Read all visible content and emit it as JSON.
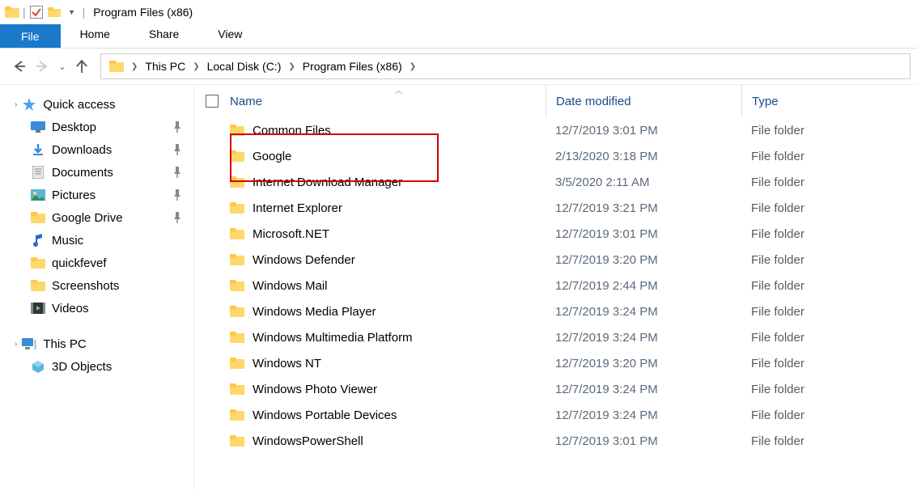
{
  "window": {
    "title": "Program Files (x86)"
  },
  "ribbon": {
    "file": "File",
    "tabs": [
      "Home",
      "Share",
      "View"
    ]
  },
  "breadcrumb": [
    "This PC",
    "Local Disk (C:)",
    "Program Files (x86)"
  ],
  "sidebar": {
    "quick_access": "Quick access",
    "items": [
      {
        "label": "Desktop",
        "pinned": true,
        "kind": "desktop"
      },
      {
        "label": "Downloads",
        "pinned": true,
        "kind": "downloads"
      },
      {
        "label": "Documents",
        "pinned": true,
        "kind": "documents"
      },
      {
        "label": "Pictures",
        "pinned": true,
        "kind": "pictures"
      },
      {
        "label": "Google Drive",
        "pinned": true,
        "kind": "folder"
      },
      {
        "label": "Music",
        "pinned": false,
        "kind": "music"
      },
      {
        "label": "quickfevef",
        "pinned": false,
        "kind": "folder"
      },
      {
        "label": "Screenshots",
        "pinned": false,
        "kind": "folder"
      },
      {
        "label": "Videos",
        "pinned": false,
        "kind": "videos"
      }
    ],
    "this_pc": "This PC",
    "objects3d": "3D Objects"
  },
  "columns": {
    "name": "Name",
    "date": "Date modified",
    "type": "Type"
  },
  "rows": [
    {
      "name": "Common Files",
      "date": "12/7/2019 3:01 PM",
      "type": "File folder"
    },
    {
      "name": "Google",
      "date": "2/13/2020 3:18 PM",
      "type": "File folder"
    },
    {
      "name": "Internet Download Manager",
      "date": "3/5/2020 2:11 AM",
      "type": "File folder"
    },
    {
      "name": "Internet Explorer",
      "date": "12/7/2019 3:21 PM",
      "type": "File folder"
    },
    {
      "name": "Microsoft.NET",
      "date": "12/7/2019 3:01 PM",
      "type": "File folder"
    },
    {
      "name": "Windows Defender",
      "date": "12/7/2019 3:20 PM",
      "type": "File folder"
    },
    {
      "name": "Windows Mail",
      "date": "12/7/2019 2:44 PM",
      "type": "File folder"
    },
    {
      "name": "Windows Media Player",
      "date": "12/7/2019 3:24 PM",
      "type": "File folder"
    },
    {
      "name": "Windows Multimedia Platform",
      "date": "12/7/2019 3:24 PM",
      "type": "File folder"
    },
    {
      "name": "Windows NT",
      "date": "12/7/2019 3:20 PM",
      "type": "File folder"
    },
    {
      "name": "Windows Photo Viewer",
      "date": "12/7/2019 3:24 PM",
      "type": "File folder"
    },
    {
      "name": "Windows Portable Devices",
      "date": "12/7/2019 3:24 PM",
      "type": "File folder"
    },
    {
      "name": "WindowsPowerShell",
      "date": "12/7/2019 3:01 PM",
      "type": "File folder"
    }
  ]
}
